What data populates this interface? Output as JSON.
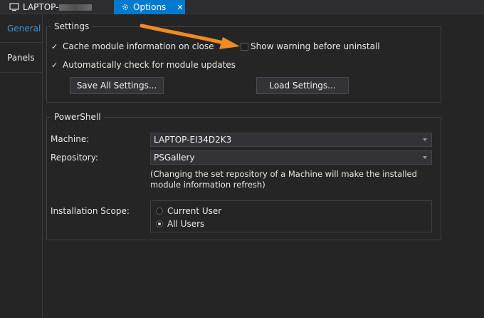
{
  "tabs": {
    "laptop_label": "LAPTOP-",
    "options_label": "Options",
    "close_glyph": "✕"
  },
  "sidebar": {
    "items": [
      {
        "label": "General"
      },
      {
        "label": "Panels"
      }
    ]
  },
  "settings": {
    "title": "Settings",
    "cache_label": "Cache module information on close",
    "cache_checked": true,
    "warn_label": "Show warning before uninstall",
    "warn_checked": false,
    "auto_label": "Automatically check for module updates",
    "auto_checked": true,
    "check_glyph": "✓",
    "save_button": "Save All Settings...",
    "load_button": "Load Settings..."
  },
  "powershell": {
    "title": "PowerShell",
    "machine_label": "Machine:",
    "machine_value": "LAPTOP-EI34D2K3",
    "repository_label": "Repository:",
    "repository_value": "PSGallery",
    "note": "(Changing the set repository of a Machine will make the installed module information refresh)",
    "scope_label": "Installation Scope:",
    "scope_options": [
      {
        "label": "Current User",
        "selected": false
      },
      {
        "label": "All Users",
        "selected": true
      }
    ]
  },
  "colors": {
    "accent": "#007acc",
    "arrow": "#f08a24",
    "background": "#252526"
  },
  "icons": {
    "tab_laptop": "computer-icon",
    "tab_options": "options-gear-icon"
  }
}
